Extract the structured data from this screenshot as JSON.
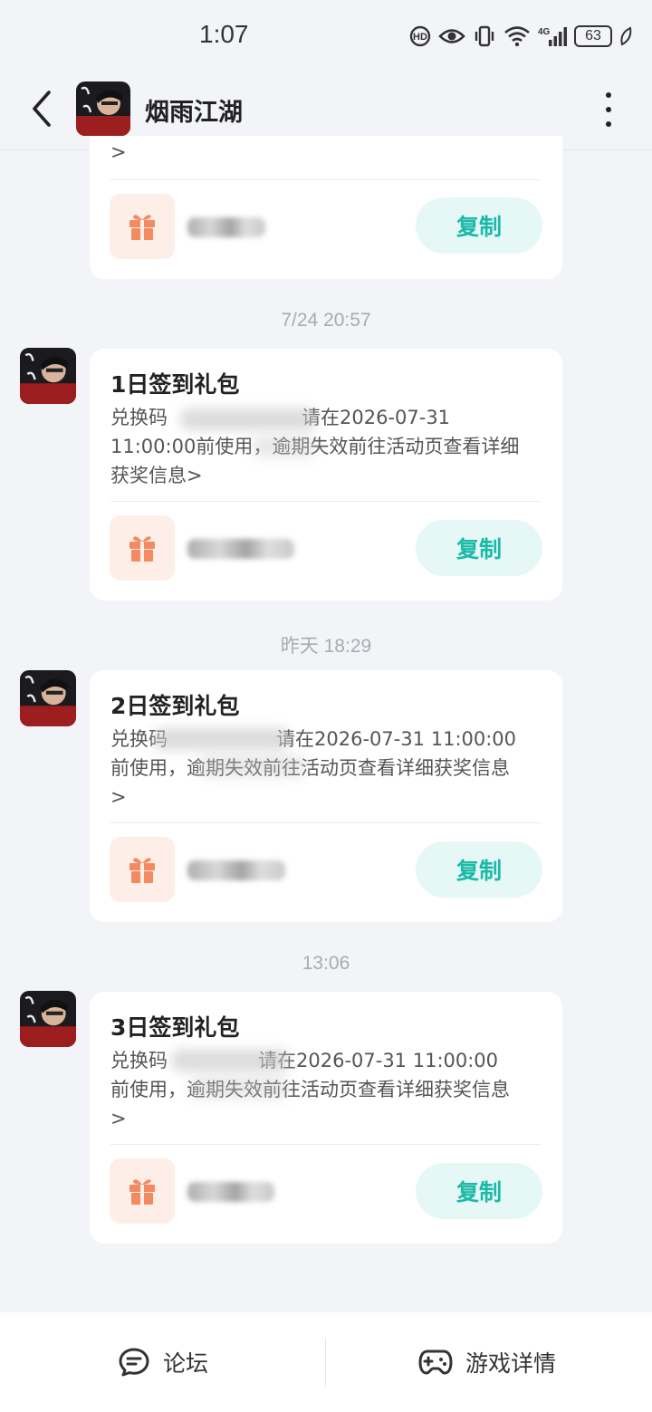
{
  "status": {
    "time": "1:07",
    "battery": "63"
  },
  "nav": {
    "title": "烟雨江湖"
  },
  "top_card": {
    "tail": ">",
    "copy_label": "复制"
  },
  "messages": [
    {
      "timestamp": "7/24  20:57",
      "title": "1日签到礼包",
      "desc_lines": [
        "兑换码",
        "请在2026-07-31",
        "11:00:00前使用，",
        "逾期失效前往活动页查看详细",
        "获奖信息>"
      ],
      "copy_label": "复制"
    },
    {
      "timestamp": "昨天  18:29",
      "title": "2日签到礼包",
      "desc_lines": [
        "兑换码",
        "请在2026-07-31 11:00:00",
        "前使用，逾期失效前往活动页查看详细获奖信息",
        ">"
      ],
      "copy_label": "复制"
    },
    {
      "timestamp": "13:06",
      "title": "3日签到礼包",
      "desc_lines": [
        "兑换码",
        "请在2026-07-31 11:00:00",
        "前使用，逾期失效前往活动页查看详细获奖信息",
        ">"
      ],
      "copy_label": "复制"
    }
  ],
  "bottom": {
    "forum": "论坛",
    "game_detail": "游戏详情"
  },
  "colors": {
    "accent": "#1bb9a8",
    "gift": "#f48a62",
    "background": "#f3f4f7"
  }
}
